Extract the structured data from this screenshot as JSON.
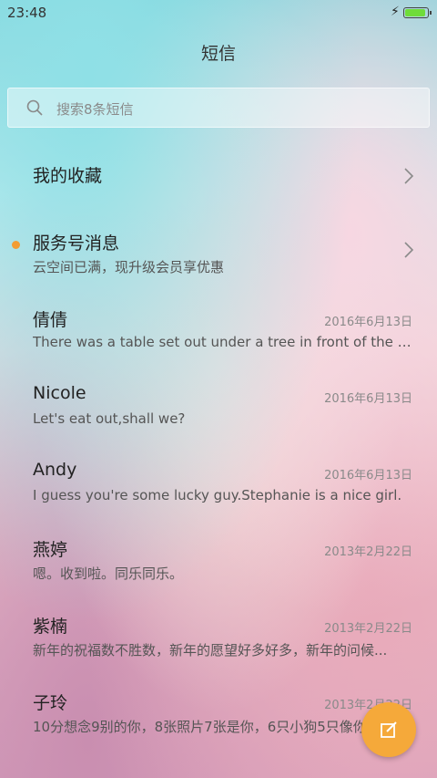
{
  "status": {
    "time": "23:48",
    "charging_icon": "lightning-icon",
    "battery_color": "#6fdc3a"
  },
  "header": {
    "title": "短信"
  },
  "search": {
    "placeholder": "搜索8条短信",
    "icon": "search-icon"
  },
  "favorites": {
    "label": "我的收藏",
    "icon": "chevron-right-icon"
  },
  "service": {
    "label": "服务号消息",
    "preview": "云空间已满，现升级会员享优惠",
    "unread_color": "#f39c33"
  },
  "messages": [
    {
      "name": "倩倩",
      "date": "2016年6月13日",
      "preview": "There was a table set out under a tree in front of the ho..."
    },
    {
      "name": "Nicole",
      "date": "2016年6月13日",
      "preview": "Let's eat out,shall we?"
    },
    {
      "name": "Andy",
      "date": "2016年6月13日",
      "preview": "I guess you're some lucky guy.Stephanie is a nice girl."
    },
    {
      "name": "燕婷",
      "date": "2013年2月22日",
      "preview": "嗯。收到啦。同乐同乐。"
    },
    {
      "name": "紫楠",
      "date": "2013年2月22日",
      "preview": "新年的祝福数不胜数，新年的愿望好多好多，新年的问候..."
    },
    {
      "name": "子玲",
      "date": "2013年2月22日",
      "preview": "10分想念9别的你，8张照片7张是你，6只小狗5只像你"
    }
  ],
  "compose": {
    "icon": "compose-icon",
    "color": "#f5a93a"
  }
}
